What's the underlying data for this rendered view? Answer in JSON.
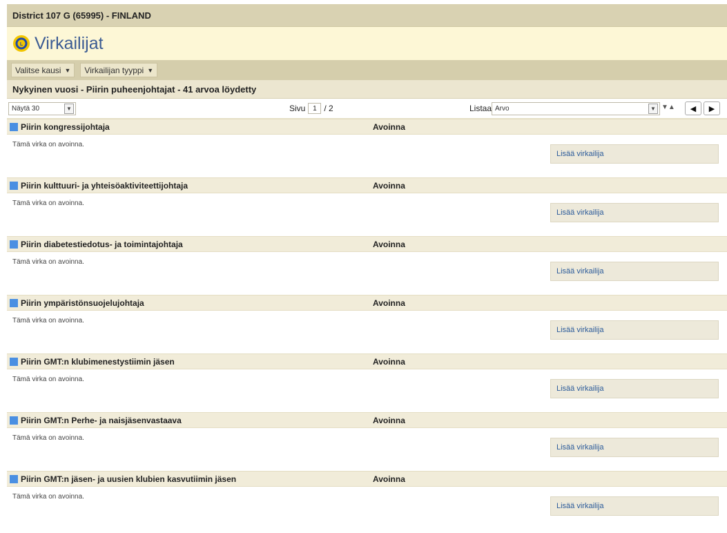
{
  "header": {
    "district": "District 107 G (65995) - FINLAND",
    "title": "Virkailijat",
    "logo": "lions-logo"
  },
  "menu": {
    "period": "Valitse kausi",
    "officer_type": "Virkailijan tyyppi"
  },
  "summary": "Nykyinen vuosi - Piirin puheenjohtajat - 41 arvoa löydetty",
  "controls": {
    "show": "Näytä 30",
    "page_label": "Sivu",
    "page_current": "1",
    "page_total": "/ 2",
    "sort_label": "Listaa",
    "sort_value": "Arvo"
  },
  "sections": [
    {
      "name": "Piirin kongressijohtaja",
      "status": "Avoinna",
      "note": "Tämä virka on avoinna.",
      "action": "Lisää virkailija"
    },
    {
      "name": "Piirin kulttuuri- ja yhteisöaktiviteettijohtaja",
      "status": "Avoinna",
      "note": "Tämä virka on avoinna.",
      "action": "Lisää virkailija"
    },
    {
      "name": "Piirin diabetestiedotus- ja toimintajohtaja",
      "status": "Avoinna",
      "note": "Tämä virka on avoinna.",
      "action": "Lisää virkailija"
    },
    {
      "name": "Piirin ympäristönsuojelujohtaja",
      "status": "Avoinna",
      "note": "Tämä virka on avoinna.",
      "action": "Lisää virkailija"
    },
    {
      "name": "Piirin GMT:n klubimenestystiimin jäsen",
      "status": "Avoinna",
      "note": "Tämä virka on avoinna.",
      "action": "Lisää virkailija"
    },
    {
      "name": "Piirin GMT:n Perhe- ja naisjäsenvastaava",
      "status": "Avoinna",
      "note": "Tämä virka on avoinna.",
      "action": "Lisää virkailija"
    },
    {
      "name": "Piirin GMT:n jäsen- ja uusien klubien kasvutiimin jäsen",
      "status": "Avoinna",
      "note": "Tämä virka on avoinna.",
      "action": "Lisää virkailija"
    }
  ],
  "colors": {
    "accent": "#3b5b93",
    "section_marker": "#4a8fe2",
    "header_bg": "#d9d2b2"
  }
}
